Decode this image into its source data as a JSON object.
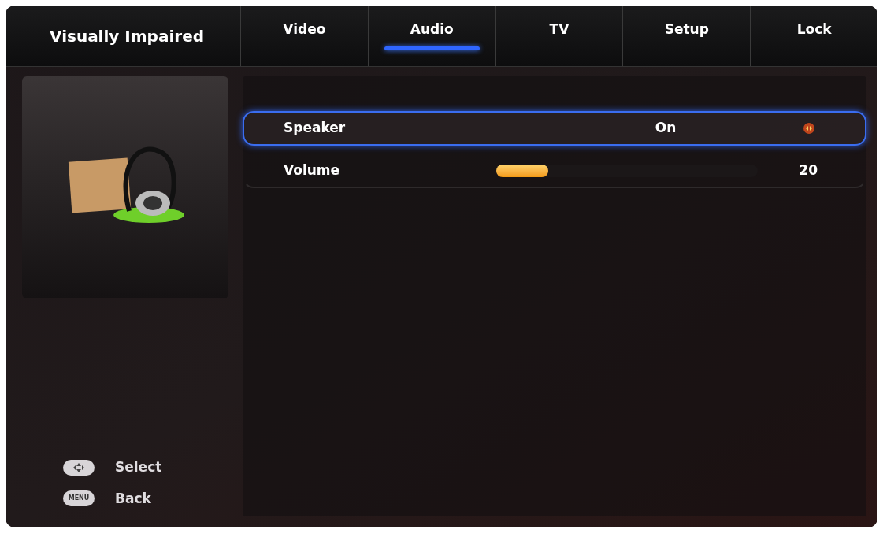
{
  "header": {
    "title": "Visually Impaired"
  },
  "tabs": [
    {
      "label": "Video",
      "selected": false
    },
    {
      "label": "Audio",
      "selected": true
    },
    {
      "label": "TV",
      "selected": false
    },
    {
      "label": "Setup",
      "selected": false
    },
    {
      "label": "Lock",
      "selected": false
    }
  ],
  "settings": [
    {
      "kind": "option",
      "label": "Speaker",
      "value": "On",
      "selected": true
    },
    {
      "kind": "slider",
      "label": "Volume",
      "level": 0.2,
      "reading": "20",
      "selected": false
    }
  ],
  "legend": [
    {
      "kind": "dpad",
      "label": "Select"
    },
    {
      "kind": "key",
      "key": "MENU",
      "label": "Back"
    }
  ]
}
